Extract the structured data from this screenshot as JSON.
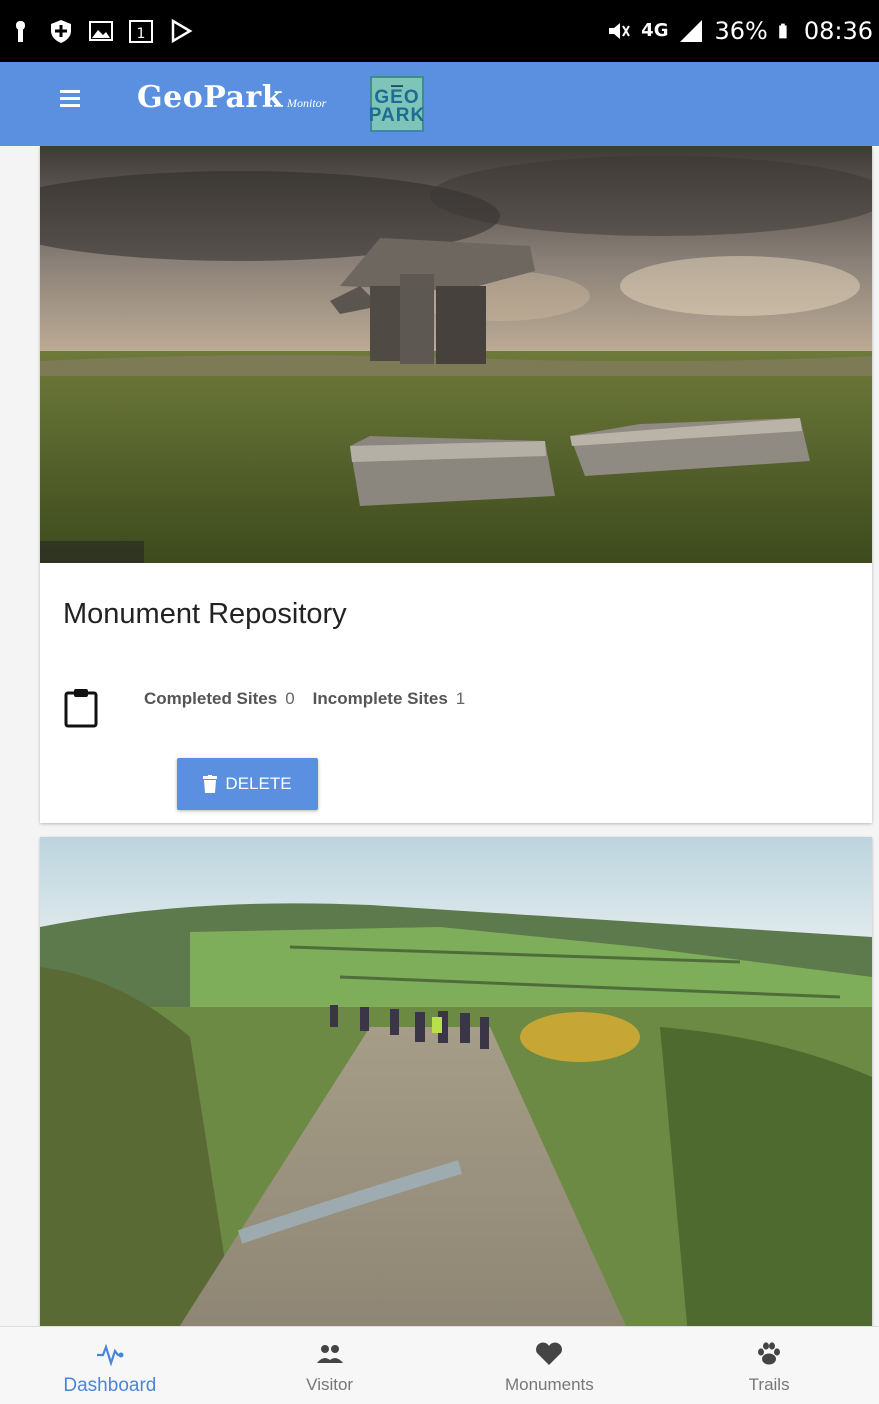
{
  "status_bar": {
    "network": "4G",
    "battery": "36%",
    "time": "08:36"
  },
  "app_bar": {
    "brand_main": "GeoPark",
    "brand_sub": "Monitor",
    "logo_text": "GEO PARK"
  },
  "cards": [
    {
      "title": "Monument Repository",
      "stats": {
        "completed_label": "Completed Sites",
        "completed_value": "0",
        "incomplete_label": "Incomplete Sites",
        "incomplete_value": "1"
      },
      "delete_label": "DELETE"
    },
    {}
  ],
  "bottom_nav": {
    "items": [
      {
        "label": "Dashboard",
        "icon": "pulse-icon"
      },
      {
        "label": "Visitor",
        "icon": "people-icon"
      },
      {
        "label": "Monuments",
        "icon": "heart-icon"
      },
      {
        "label": "Trails",
        "icon": "paw-icon"
      }
    ],
    "active": "Dashboard"
  },
  "colors": {
    "primary": "#5a90df",
    "active_nav": "#4a86d8"
  }
}
